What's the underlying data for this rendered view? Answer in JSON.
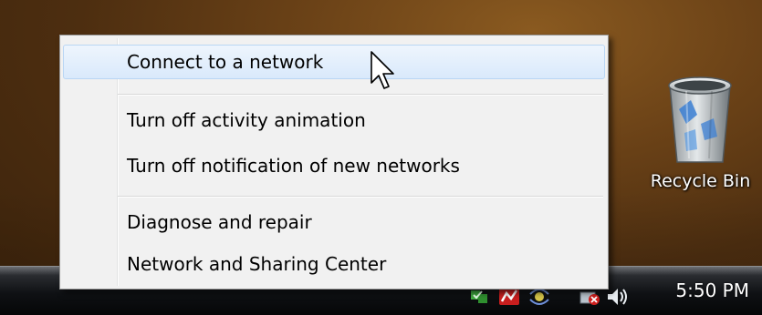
{
  "menu": {
    "items": [
      {
        "label": "Connect to a network"
      },
      {
        "label": "Turn off activity animation"
      },
      {
        "label": "Turn off notification of new networks"
      },
      {
        "label": "Diagnose and repair"
      },
      {
        "label": "Network and Sharing Center"
      }
    ]
  },
  "desktop": {
    "recycle_bin_label": "Recycle Bin"
  },
  "taskbar": {
    "clock": "5:50 PM"
  },
  "icons": {
    "tray": [
      "network-activity-icon",
      "network-error-icon",
      "wireless-icon",
      "network-status-icon",
      "volume-icon"
    ],
    "desktop": [
      "recycle-bin-icon"
    ],
    "cursor": "mouse-cursor-icon"
  },
  "colors": {
    "menu_background": "#f1f1f1",
    "hover_highlight": "#d9e9fb",
    "hover_border": "#b9d6f4",
    "taskbar": "#0f1114"
  }
}
